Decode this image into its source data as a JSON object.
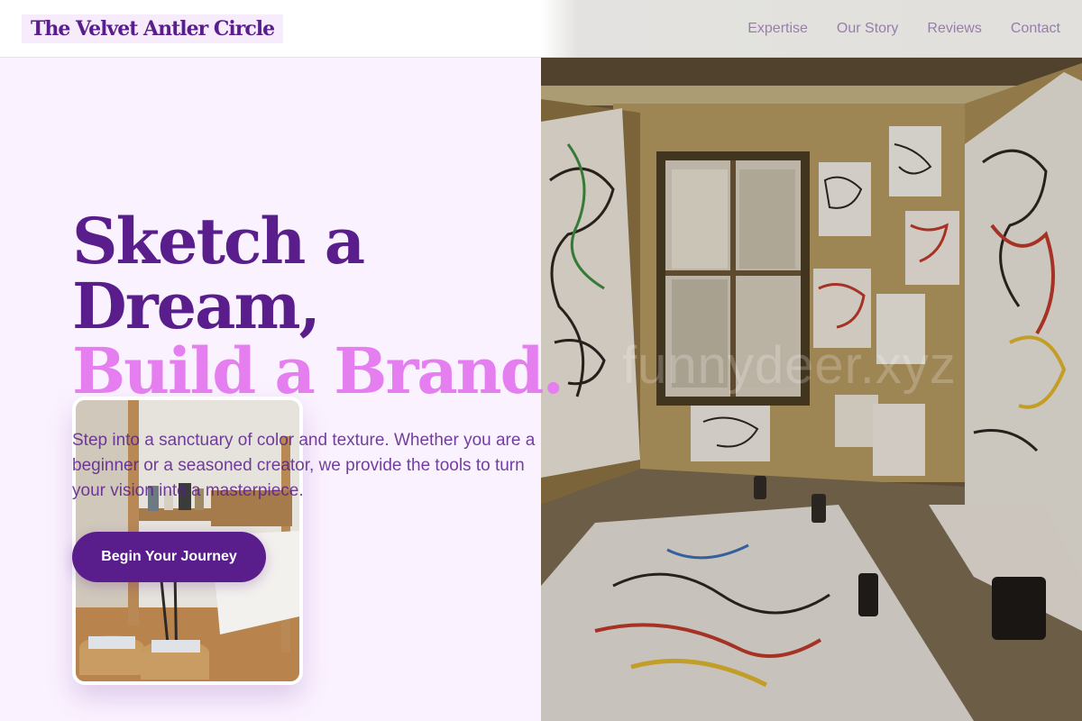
{
  "header": {
    "logo": "The Velvet Antler Circle",
    "nav": [
      "Expertise",
      "Our Story",
      "Reviews",
      "Contact"
    ]
  },
  "hero": {
    "headline_line1": "Sketch a",
    "headline_line2": "Dream,",
    "headline_line3": "Build a Brand.",
    "subtext": "Step into a sanctuary of color and texture. Whether you are a beginner or a seasoned creator, we provide the tools to turn your vision into a masterpiece.",
    "cta_label": "Begin Your Journey"
  },
  "watermark": "funnydeer.xyz",
  "colors": {
    "brand_purple": "#5a1e8c",
    "accent_pink": "#e57ff0",
    "page_background": "#fbf2ff"
  }
}
